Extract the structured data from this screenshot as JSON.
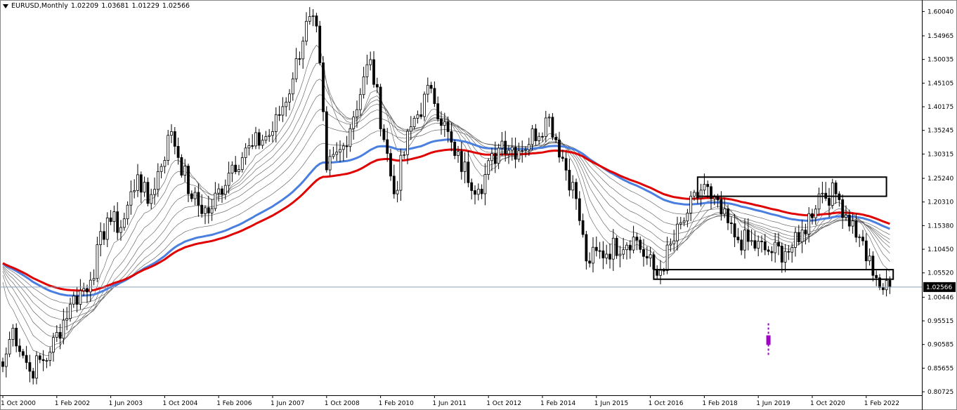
{
  "header": {
    "symbol": "EURUSD,Monthly",
    "open": "1.02209",
    "high": "1.03681",
    "low": "1.01229",
    "close": "1.02566"
  },
  "colors": {
    "background": "#ffffff",
    "candle_up": "#ffffff",
    "candle_down": "#000000",
    "candle_border": "#000000",
    "ma_red": "#e00000",
    "ma_blue": "#4a7fe0",
    "ma_thin": "#555555",
    "price_line": "#8aa0b8",
    "last_price_bg": "#000000",
    "last_price_text": "#ffffff",
    "marker": "#a000c8"
  },
  "chart_data": {
    "type": "candlestick",
    "symbol": "EURUSD",
    "timeframe": "Monthly",
    "ylim": [
      0.8,
      1.62
    ],
    "xlim": [
      "2000-10",
      "2022-09"
    ],
    "y_ticks": [
      "1.60040",
      "1.54965",
      "1.50035",
      "1.45105",
      "1.40175",
      "1.35245",
      "1.30315",
      "1.25240",
      "1.20310",
      "1.15380",
      "1.10450",
      "1.05520",
      "1.00446",
      "0.95515",
      "0.90585",
      "0.85655",
      "0.80725"
    ],
    "x_ticks": [
      "1 Oct 2000",
      "1 Feb 2002",
      "1 Jun 2003",
      "1 Oct 2004",
      "1 Feb 2006",
      "1 Jun 2007",
      "1 Oct 2008",
      "1 Feb 2010",
      "1 Jun 2011",
      "1 Oct 2012",
      "1 Feb 2014",
      "1 Jun 2015",
      "1 Oct 2016",
      "1 Feb 2018",
      "1 Jun 2019",
      "1 Oct 2020",
      "1 Feb 2022"
    ],
    "last_price": "1.02566",
    "anchors": [
      [
        "2000-10",
        0.86
      ],
      [
        "2001-01",
        0.94
      ],
      [
        "2001-06",
        0.85
      ],
      [
        "2001-12",
        0.89
      ],
      [
        "2002-06",
        0.99
      ],
      [
        "2002-12",
        1.04
      ],
      [
        "2003-05",
        1.17
      ],
      [
        "2003-09",
        1.15
      ],
      [
        "2004-02",
        1.26
      ],
      [
        "2004-05",
        1.2
      ],
      [
        "2004-12",
        1.35
      ],
      [
        "2005-06",
        1.21
      ],
      [
        "2005-11",
        1.18
      ],
      [
        "2006-06",
        1.28
      ],
      [
        "2006-12",
        1.32
      ],
      [
        "2007-06",
        1.35
      ],
      [
        "2007-12",
        1.46
      ],
      [
        "2008-04",
        1.58
      ],
      [
        "2008-07",
        1.57
      ],
      [
        "2008-10",
        1.27
      ],
      [
        "2009-03",
        1.32
      ],
      [
        "2009-11",
        1.5
      ],
      [
        "2010-06",
        1.22
      ],
      [
        "2010-11",
        1.36
      ],
      [
        "2011-05",
        1.44
      ],
      [
        "2011-12",
        1.3
      ],
      [
        "2012-07",
        1.23
      ],
      [
        "2013-02",
        1.33
      ],
      [
        "2013-07",
        1.31
      ],
      [
        "2014-04",
        1.38
      ],
      [
        "2014-12",
        1.21
      ],
      [
        "2015-03",
        1.08
      ],
      [
        "2016-05",
        1.13
      ],
      [
        "2016-12",
        1.05
      ],
      [
        "2017-09",
        1.18
      ],
      [
        "2018-02",
        1.24
      ],
      [
        "2018-04",
        1.21
      ],
      [
        "2018-11",
        1.13
      ],
      [
        "2019-09",
        1.1
      ],
      [
        "2020-02",
        1.1
      ],
      [
        "2020-06",
        1.12
      ],
      [
        "2020-12",
        1.22
      ],
      [
        "2021-05",
        1.22
      ],
      [
        "2021-12",
        1.13
      ],
      [
        "2022-04",
        1.05
      ],
      [
        "2022-07",
        1.02
      ],
      [
        "2022-09",
        1.026
      ]
    ],
    "moving_averages": [
      {
        "color": "red",
        "period": 100
      },
      {
        "color": "blue",
        "period": 80
      },
      {
        "color": "thin",
        "period": 60
      },
      {
        "color": "thin",
        "period": 45
      },
      {
        "color": "thin",
        "period": 35
      },
      {
        "color": "thin",
        "period": 27
      },
      {
        "color": "thin",
        "period": 20
      },
      {
        "color": "thin",
        "period": 14
      },
      {
        "color": "thin",
        "period": 9
      }
    ],
    "zones": [
      {
        "start": "2017-12",
        "end": "2022-08",
        "low": 1.215,
        "high": 1.255
      },
      {
        "start": "2016-11",
        "end": "2022-10",
        "low": 1.042,
        "high": 1.062
      }
    ],
    "marker_point": {
      "date": "2019-09",
      "low": 0.88,
      "high": 0.95
    }
  }
}
